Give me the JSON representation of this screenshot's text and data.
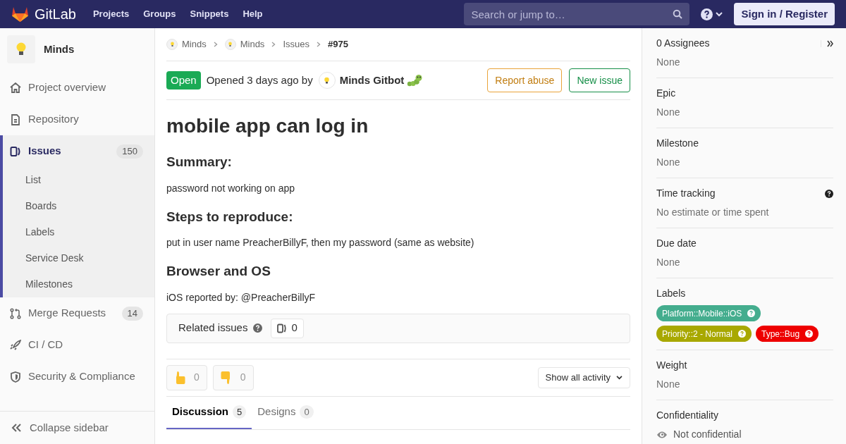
{
  "header": {
    "brand": "GitLab",
    "nav": [
      "Projects",
      "Groups",
      "Snippets",
      "Help"
    ],
    "search": {
      "placeholder": "Search or jump to…"
    },
    "sign_in": "Sign in / Register"
  },
  "sidebar": {
    "project": "Minds",
    "items": [
      {
        "kind": "home",
        "label": "Project overview",
        "selected": false
      },
      {
        "kind": "doc",
        "label": "Repository",
        "selected": false
      },
      {
        "kind": "issues",
        "label": "Issues",
        "count": "150",
        "selected": true,
        "children": [
          {
            "label": "List"
          },
          {
            "label": "Boards"
          },
          {
            "label": "Labels"
          },
          {
            "label": "Service Desk"
          },
          {
            "label": "Milestones"
          }
        ]
      },
      {
        "kind": "merge",
        "label": "Merge Requests",
        "count": "14",
        "selected": false
      },
      {
        "kind": "rocket",
        "label": "CI / CD",
        "selected": false
      },
      {
        "kind": "shield",
        "label": "Security & Compliance",
        "selected": false
      }
    ],
    "collapse": "Collapse sidebar"
  },
  "breadcrumbs": [
    {
      "kind": "avatar",
      "label": "Minds"
    },
    {
      "kind": "avatar",
      "label": "Minds"
    },
    {
      "kind": "plain",
      "label": "Issues"
    },
    {
      "kind": "current",
      "label": "#975"
    }
  ],
  "issue": {
    "status": "Open",
    "opened": "Opened 3 days ago by",
    "author": "Minds Gitbot",
    "actions": [
      {
        "kind": "warning",
        "label": "Report abuse"
      },
      {
        "kind": "success",
        "label": "New issue"
      }
    ],
    "title": "mobile app can log in",
    "body": [
      {
        "kind": "heading",
        "text": "Summary:"
      },
      {
        "kind": "paragraph",
        "text": "password not working on app"
      },
      {
        "kind": "heading",
        "text": "Steps to reproduce:"
      },
      {
        "kind": "paragraph",
        "text": "put in user name PreacherBillyF, then my password (same as website)"
      },
      {
        "kind": "heading",
        "text": "Browser and OS"
      },
      {
        "kind": "paragraph",
        "text": "iOS reported by: @PreacherBillyF"
      }
    ]
  },
  "related_issues": {
    "label": "Related issues",
    "count": "0"
  },
  "reactions": [
    {
      "kind": "up",
      "count": "0"
    },
    {
      "kind": "down",
      "count": "0"
    }
  ],
  "activity_filter": "Show all activity",
  "tabs": [
    {
      "label": "Discussion",
      "count": "5",
      "selected": true
    },
    {
      "label": "Designs",
      "count": "0",
      "selected": false
    }
  ],
  "right_sidebar": {
    "sections": [
      {
        "title": "0 Assignees",
        "value": "None",
        "kind": "assignees"
      },
      {
        "title": "Epic",
        "value": "None"
      },
      {
        "title": "Milestone",
        "value": "None"
      },
      {
        "title": "Time tracking",
        "value": "No estimate or time spent",
        "kind": "help"
      },
      {
        "title": "Due date",
        "value": "None"
      },
      {
        "title": "Labels",
        "labels": [
          {
            "text": "Platform::Mobile::iOS",
            "color": "#44ad8e"
          },
          {
            "text": "Priority::2 - Normal",
            "color": "#a8a800"
          },
          {
            "text": "Type::Bug",
            "color": "#ee0000"
          }
        ]
      },
      {
        "title": "Weight",
        "value": "None"
      },
      {
        "title": "Confidentiality",
        "value": "Not confidential",
        "kind": "eye"
      }
    ]
  }
}
